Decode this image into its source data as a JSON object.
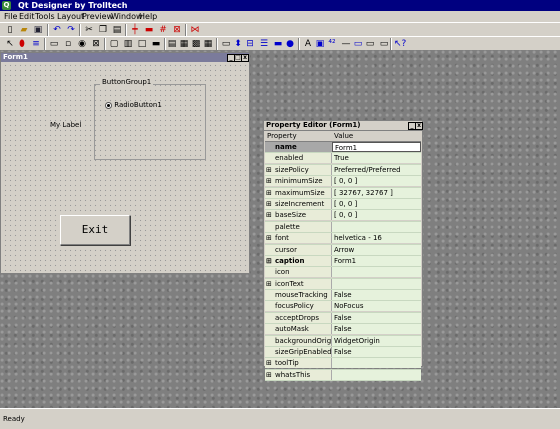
{
  "app": {
    "title": "Qt Designer by Trolltech"
  },
  "menu": [
    "File",
    "Edit",
    "Tools",
    "Layout",
    "Preview",
    "Window",
    "Help"
  ],
  "toolbar": {
    "row1": [
      "new-file",
      "open-file",
      "save-file",
      "undo",
      "redo",
      "cut",
      "copy",
      "paste",
      "layout-horizontal",
      "layout-vertical",
      "layout-grid",
      "break-layout",
      "adjust-size"
    ],
    "row2": [
      "pointer",
      "connect",
      "tab-order",
      "push-button",
      "tool-button",
      "radio-button",
      "check-box",
      "group-box",
      "button-group",
      "frame",
      "tab-widget",
      "list-box",
      "list-view",
      "icon-view",
      "table",
      "line-edit",
      "spin-box",
      "slider",
      "combo-box",
      "progress-bar",
      "dial",
      "label",
      "pixmap-label",
      "lcd-number",
      "line",
      "dock",
      "scroll",
      "whats-this"
    ]
  },
  "form1": {
    "title": "Form1",
    "groupbox_title": "ButtonGroup1",
    "radio_label": "RadioButton1",
    "label_text": "My Label",
    "exit_label": "Exit"
  },
  "property_editor": {
    "title": "Property Editor (Form1)",
    "col_property": "Property",
    "col_value": "Value",
    "rows": [
      {
        "name": "name",
        "value": "Form1",
        "expand": "",
        "selected": true,
        "bold": true
      },
      {
        "name": "enabled",
        "value": "True",
        "expand": ""
      },
      {
        "name": "sizePolicy",
        "value": "Preferred/Preferred",
        "expand": "⊞"
      },
      {
        "name": "minimumSize",
        "value": "[ 0, 0 ]",
        "expand": "⊞"
      },
      {
        "name": "maximumSize",
        "value": "[ 32767, 32767 ]",
        "expand": "⊞"
      },
      {
        "name": "sizeIncrement",
        "value": "[ 0, 0 ]",
        "expand": "⊞"
      },
      {
        "name": "baseSize",
        "value": "[ 0, 0 ]",
        "expand": "⊞"
      },
      {
        "name": "palette",
        "value": "",
        "expand": ""
      },
      {
        "name": "font",
        "value": "helvetica - 16",
        "expand": "⊞"
      },
      {
        "name": "cursor",
        "value": "Arrow",
        "expand": ""
      },
      {
        "name": "caption",
        "value": "Form1",
        "expand": "⊞",
        "bold": true
      },
      {
        "name": "icon",
        "value": "",
        "expand": ""
      },
      {
        "name": "iconText",
        "value": "",
        "expand": "⊞"
      },
      {
        "name": "mouseTracking",
        "value": "False",
        "expand": ""
      },
      {
        "name": "focusPolicy",
        "value": "NoFocus",
        "expand": ""
      },
      {
        "name": "acceptDrops",
        "value": "False",
        "expand": ""
      },
      {
        "name": "autoMask",
        "value": "False",
        "expand": ""
      },
      {
        "name": "backgroundOrigin",
        "value": "WidgetOrigin",
        "expand": ""
      },
      {
        "name": "sizeGripEnabled",
        "value": "False",
        "expand": ""
      },
      {
        "name": "toolTip",
        "value": "",
        "expand": "⊞"
      },
      {
        "name": "whatsThis",
        "value": "",
        "expand": "⊞"
      }
    ]
  },
  "status": {
    "text": "Ready"
  }
}
